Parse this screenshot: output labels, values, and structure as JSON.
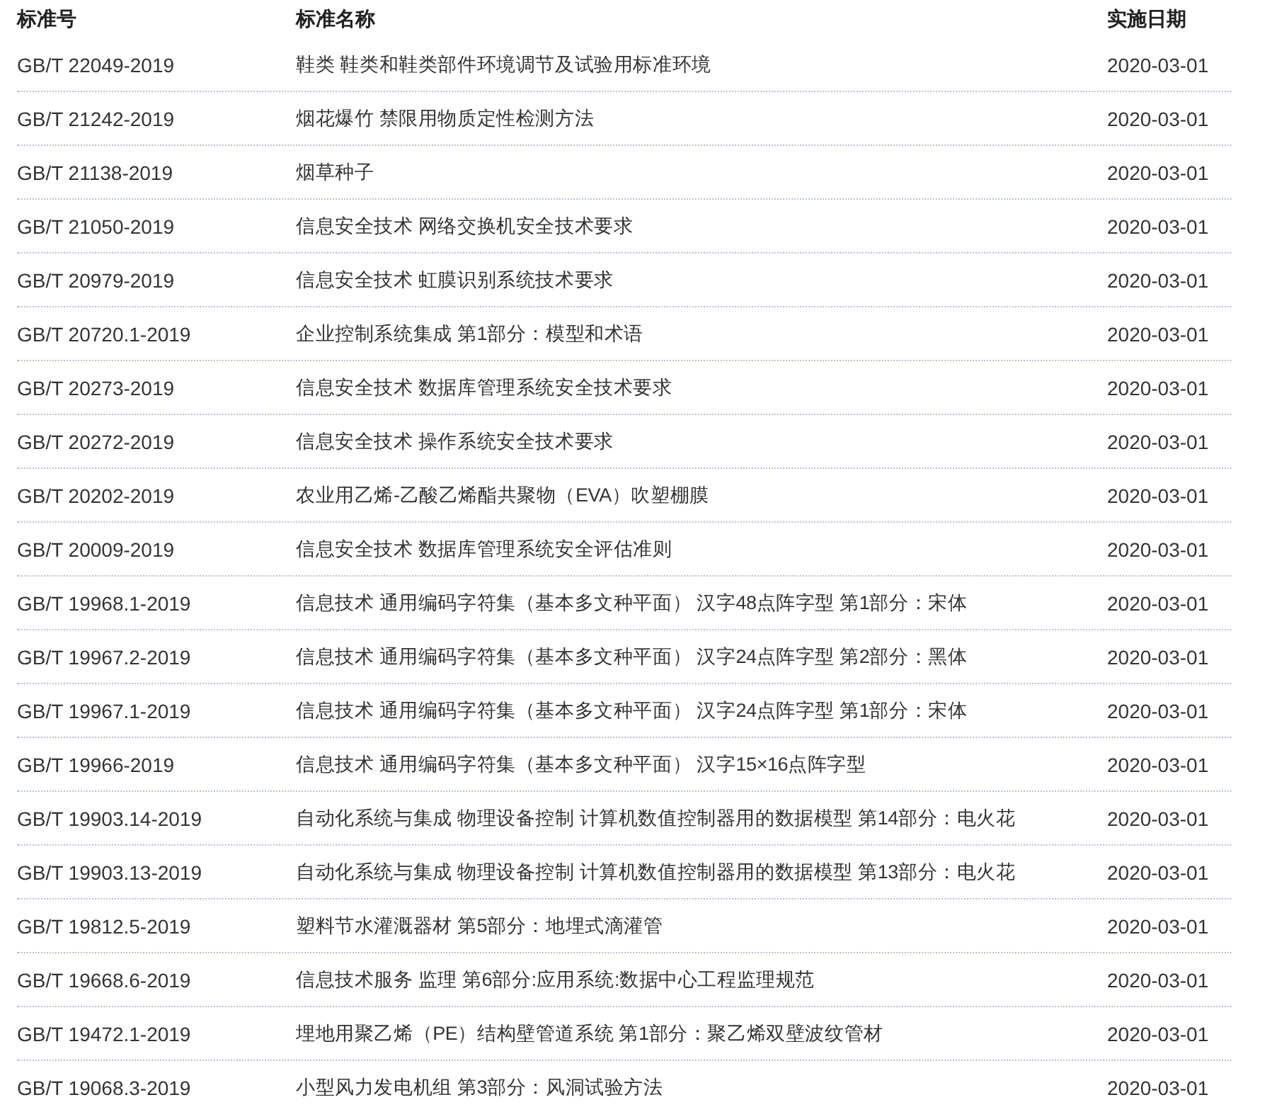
{
  "table": {
    "columns": [
      "标准号",
      "标准名称",
      "实施日期"
    ],
    "rows": [
      {
        "code": "GB/T 22049-2019",
        "name": "鞋类 鞋类和鞋类部件环境调节及试验用标准环境",
        "date": "2020-03-01"
      },
      {
        "code": "GB/T 21242-2019",
        "name": "烟花爆竹 禁限用物质定性检测方法",
        "date": "2020-03-01"
      },
      {
        "code": "GB/T 21138-2019",
        "name": "烟草种子",
        "date": "2020-03-01"
      },
      {
        "code": "GB/T 21050-2019",
        "name": "信息安全技术 网络交换机安全技术要求",
        "date": "2020-03-01"
      },
      {
        "code": "GB/T 20979-2019",
        "name": "信息安全技术 虹膜识别系统技术要求",
        "date": "2020-03-01"
      },
      {
        "code": "GB/T 20720.1-2019",
        "name": "企业控制系统集成 第1部分：模型和术语",
        "date": "2020-03-01"
      },
      {
        "code": "GB/T 20273-2019",
        "name": "信息安全技术 数据库管理系统安全技术要求",
        "date": "2020-03-01"
      },
      {
        "code": "GB/T 20272-2019",
        "name": "信息安全技术 操作系统安全技术要求",
        "date": "2020-03-01"
      },
      {
        "code": "GB/T 20202-2019",
        "name": "农业用乙烯-乙酸乙烯酯共聚物（EVA）吹塑棚膜",
        "date": "2020-03-01"
      },
      {
        "code": "GB/T 20009-2019",
        "name": "信息安全技术 数据库管理系统安全评估准则",
        "date": "2020-03-01"
      },
      {
        "code": "GB/T 19968.1-2019",
        "name": "信息技术 通用编码字符集（基本多文种平面） 汉字48点阵字型 第1部分：宋体",
        "date": "2020-03-01"
      },
      {
        "code": "GB/T 19967.2-2019",
        "name": "信息技术 通用编码字符集（基本多文种平面） 汉字24点阵字型 第2部分：黑体",
        "date": "2020-03-01"
      },
      {
        "code": "GB/T 19967.1-2019",
        "name": "信息技术 通用编码字符集（基本多文种平面） 汉字24点阵字型 第1部分：宋体",
        "date": "2020-03-01"
      },
      {
        "code": "GB/T 19966-2019",
        "name": "信息技术 通用编码字符集（基本多文种平面） 汉字15×16点阵字型",
        "date": "2020-03-01"
      },
      {
        "code": "GB/T 19903.14-2019",
        "name": "自动化系统与集成 物理设备控制 计算机数值控制器用的数据模型 第14部分：电火花",
        "date": "2020-03-01"
      },
      {
        "code": "GB/T 19903.13-2019",
        "name": "自动化系统与集成 物理设备控制 计算机数值控制器用的数据模型 第13部分：电火花",
        "date": "2020-03-01"
      },
      {
        "code": "GB/T 19812.5-2019",
        "name": "塑料节水灌溉器材 第5部分：地埋式滴灌管",
        "date": "2020-03-01"
      },
      {
        "code": "GB/T 19668.6-2019",
        "name": "信息技术服务 监理 第6部分:应用系统:数据中心工程监理规范",
        "date": "2020-03-01"
      },
      {
        "code": "GB/T 19472.1-2019",
        "name": "埋地用聚乙烯（PE）结构壁管道系统 第1部分：聚乙烯双壁波纹管材",
        "date": "2020-03-01"
      },
      {
        "code": "GB/T 19068.3-2019",
        "name": "小型风力发电机组 第3部分：风洞试验方法",
        "date": "2020-03-01"
      }
    ]
  }
}
